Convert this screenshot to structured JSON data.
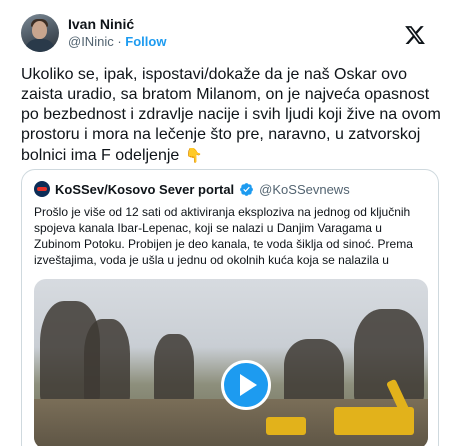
{
  "author": {
    "name": "Ivan Ninić",
    "handle": "@INinic",
    "separator": "·",
    "follow_label": "Follow"
  },
  "tweet": {
    "text": "Ukoliko se, ipak, ispostavi/dokaže da je naš Oskar ovo zaista uradio, sa bratom Milanom, on je najveća opasnost po bezbednost i zdravlje nacije i svih ljudi koji žive na ovom prostoru i mora na lečenje što pre, naravno, u zatvorskoj bolnici ima F odeljenje",
    "emoji": "👇"
  },
  "quote": {
    "name": "KoSSev/Kosovo Sever portal",
    "handle": "@KoSSevnews",
    "text": "Prošlo je više od 12 sati od aktiviranja eksploziva na jednog od ključnih spojeva kanala Ibar-Lepenac, koji se nalazi u Danjim Varagama u Zubinom Potoku. Probijen je deo kanala, te voda šiklja od sinoć. Prema izveštajima, voda je ušla u jednu od okolnih kuća koja se nalazila u"
  },
  "icons": {
    "platform": "x-logo",
    "verified": "verified-badge-icon",
    "video": "play-icon"
  },
  "colors": {
    "accent": "#1d9bf0",
    "text": "#0f1419",
    "muted": "#536471",
    "border": "#cfd9de"
  }
}
